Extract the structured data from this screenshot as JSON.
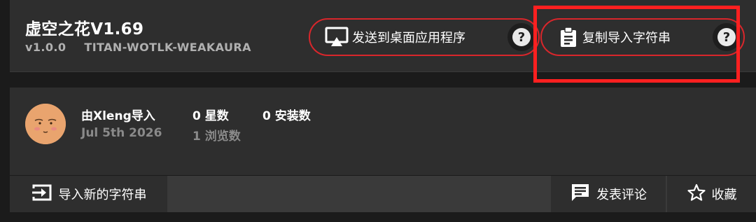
{
  "header": {
    "title": "虚空之花V1.69",
    "version": "v1.0.0",
    "source": "TITAN-WOTLK-WEAKAURA",
    "send_label": "发送到桌面应用程序",
    "copy_label": "复制导入字符串",
    "help_glyph": "?",
    "highlight_color": "#ff2020",
    "outline_color": "#d9262b"
  },
  "info": {
    "author": "由Xleng导入",
    "date": "Jul 5th 2026",
    "stars": "0 星数",
    "installs": "0 安装数",
    "views": "1 浏览数"
  },
  "actions": {
    "import_label": "导入新的字符串",
    "comment_label": "发表评论",
    "favorite_label": "收藏"
  },
  "icons": {
    "send": "cast-to-desktop-icon",
    "copy": "clipboard-icon",
    "help": "help-icon",
    "import": "import-icon",
    "comment": "comment-icon",
    "favorite": "star-icon"
  }
}
